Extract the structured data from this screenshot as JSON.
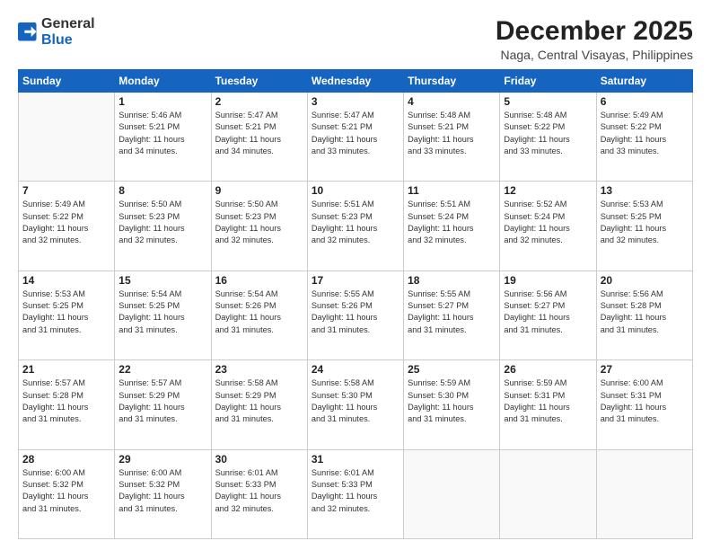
{
  "logo": {
    "general": "General",
    "blue": "Blue"
  },
  "title": "December 2025",
  "location": "Naga, Central Visayas, Philippines",
  "days_header": [
    "Sunday",
    "Monday",
    "Tuesday",
    "Wednesday",
    "Thursday",
    "Friday",
    "Saturday"
  ],
  "weeks": [
    [
      {
        "num": "",
        "info": ""
      },
      {
        "num": "1",
        "info": "Sunrise: 5:46 AM\nSunset: 5:21 PM\nDaylight: 11 hours\nand 34 minutes."
      },
      {
        "num": "2",
        "info": "Sunrise: 5:47 AM\nSunset: 5:21 PM\nDaylight: 11 hours\nand 34 minutes."
      },
      {
        "num": "3",
        "info": "Sunrise: 5:47 AM\nSunset: 5:21 PM\nDaylight: 11 hours\nand 33 minutes."
      },
      {
        "num": "4",
        "info": "Sunrise: 5:48 AM\nSunset: 5:21 PM\nDaylight: 11 hours\nand 33 minutes."
      },
      {
        "num": "5",
        "info": "Sunrise: 5:48 AM\nSunset: 5:22 PM\nDaylight: 11 hours\nand 33 minutes."
      },
      {
        "num": "6",
        "info": "Sunrise: 5:49 AM\nSunset: 5:22 PM\nDaylight: 11 hours\nand 33 minutes."
      }
    ],
    [
      {
        "num": "7",
        "info": "Sunrise: 5:49 AM\nSunset: 5:22 PM\nDaylight: 11 hours\nand 32 minutes."
      },
      {
        "num": "8",
        "info": "Sunrise: 5:50 AM\nSunset: 5:23 PM\nDaylight: 11 hours\nand 32 minutes."
      },
      {
        "num": "9",
        "info": "Sunrise: 5:50 AM\nSunset: 5:23 PM\nDaylight: 11 hours\nand 32 minutes."
      },
      {
        "num": "10",
        "info": "Sunrise: 5:51 AM\nSunset: 5:23 PM\nDaylight: 11 hours\nand 32 minutes."
      },
      {
        "num": "11",
        "info": "Sunrise: 5:51 AM\nSunset: 5:24 PM\nDaylight: 11 hours\nand 32 minutes."
      },
      {
        "num": "12",
        "info": "Sunrise: 5:52 AM\nSunset: 5:24 PM\nDaylight: 11 hours\nand 32 minutes."
      },
      {
        "num": "13",
        "info": "Sunrise: 5:53 AM\nSunset: 5:25 PM\nDaylight: 11 hours\nand 32 minutes."
      }
    ],
    [
      {
        "num": "14",
        "info": "Sunrise: 5:53 AM\nSunset: 5:25 PM\nDaylight: 11 hours\nand 31 minutes."
      },
      {
        "num": "15",
        "info": "Sunrise: 5:54 AM\nSunset: 5:25 PM\nDaylight: 11 hours\nand 31 minutes."
      },
      {
        "num": "16",
        "info": "Sunrise: 5:54 AM\nSunset: 5:26 PM\nDaylight: 11 hours\nand 31 minutes."
      },
      {
        "num": "17",
        "info": "Sunrise: 5:55 AM\nSunset: 5:26 PM\nDaylight: 11 hours\nand 31 minutes."
      },
      {
        "num": "18",
        "info": "Sunrise: 5:55 AM\nSunset: 5:27 PM\nDaylight: 11 hours\nand 31 minutes."
      },
      {
        "num": "19",
        "info": "Sunrise: 5:56 AM\nSunset: 5:27 PM\nDaylight: 11 hours\nand 31 minutes."
      },
      {
        "num": "20",
        "info": "Sunrise: 5:56 AM\nSunset: 5:28 PM\nDaylight: 11 hours\nand 31 minutes."
      }
    ],
    [
      {
        "num": "21",
        "info": "Sunrise: 5:57 AM\nSunset: 5:28 PM\nDaylight: 11 hours\nand 31 minutes."
      },
      {
        "num": "22",
        "info": "Sunrise: 5:57 AM\nSunset: 5:29 PM\nDaylight: 11 hours\nand 31 minutes."
      },
      {
        "num": "23",
        "info": "Sunrise: 5:58 AM\nSunset: 5:29 PM\nDaylight: 11 hours\nand 31 minutes."
      },
      {
        "num": "24",
        "info": "Sunrise: 5:58 AM\nSunset: 5:30 PM\nDaylight: 11 hours\nand 31 minutes."
      },
      {
        "num": "25",
        "info": "Sunrise: 5:59 AM\nSunset: 5:30 PM\nDaylight: 11 hours\nand 31 minutes."
      },
      {
        "num": "26",
        "info": "Sunrise: 5:59 AM\nSunset: 5:31 PM\nDaylight: 11 hours\nand 31 minutes."
      },
      {
        "num": "27",
        "info": "Sunrise: 6:00 AM\nSunset: 5:31 PM\nDaylight: 11 hours\nand 31 minutes."
      }
    ],
    [
      {
        "num": "28",
        "info": "Sunrise: 6:00 AM\nSunset: 5:32 PM\nDaylight: 11 hours\nand 31 minutes."
      },
      {
        "num": "29",
        "info": "Sunrise: 6:00 AM\nSunset: 5:32 PM\nDaylight: 11 hours\nand 31 minutes."
      },
      {
        "num": "30",
        "info": "Sunrise: 6:01 AM\nSunset: 5:33 PM\nDaylight: 11 hours\nand 32 minutes."
      },
      {
        "num": "31",
        "info": "Sunrise: 6:01 AM\nSunset: 5:33 PM\nDaylight: 11 hours\nand 32 minutes."
      },
      {
        "num": "",
        "info": ""
      },
      {
        "num": "",
        "info": ""
      },
      {
        "num": "",
        "info": ""
      }
    ]
  ]
}
